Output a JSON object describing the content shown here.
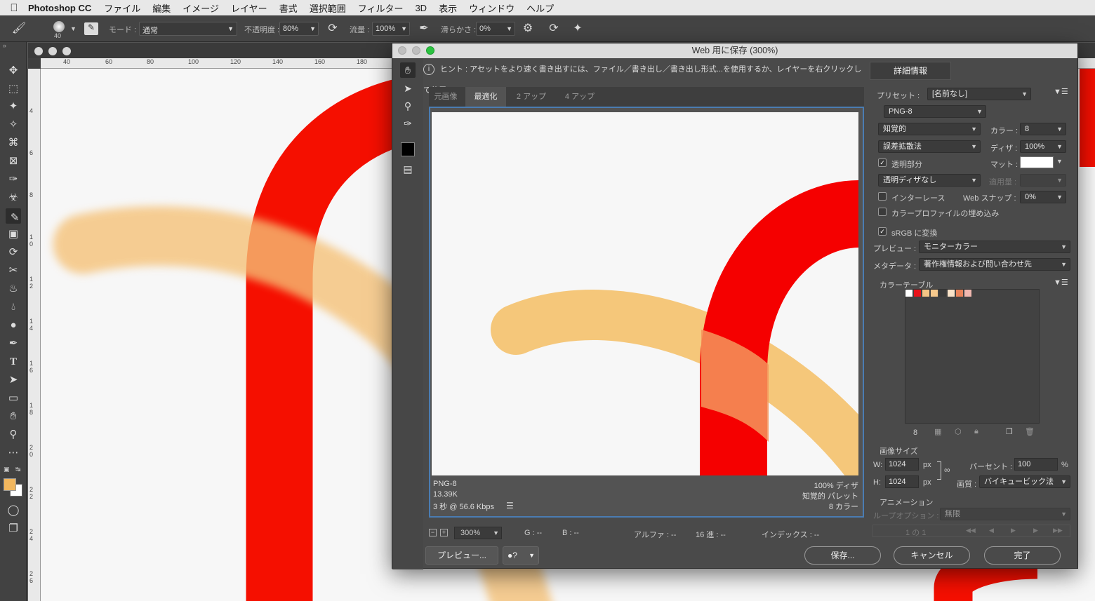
{
  "menubar": {
    "app": "Photoshop CC",
    "items": [
      "ファイル",
      "編集",
      "イメージ",
      "レイヤー",
      "書式",
      "選択範囲",
      "フィルター",
      "3D",
      "表示",
      "ウィンドウ",
      "ヘルプ"
    ]
  },
  "options": {
    "brush_size": "40",
    "mode_label": "モード :",
    "mode_value": "通常",
    "opacity_label": "不透明度 :",
    "opacity_value": "80%",
    "flow_label": "流量 :",
    "flow_value": "100%",
    "smoothing_label": "滑らかさ :",
    "smoothing_value": "0%"
  },
  "ruler": {
    "h_labels": [
      "40",
      "60",
      "80",
      "100",
      "120",
      "140",
      "160",
      "180"
    ],
    "v_labels": [
      "4",
      "6",
      "8",
      "1 0",
      "1 2",
      "1 4",
      "1 6",
      "1 8",
      "2 0",
      "2 2",
      "2 4",
      "2 6"
    ]
  },
  "colors": {
    "foreground": "#f2b75e",
    "background": "#ffffff",
    "red": "#f50f00",
    "orange_stroke": "#f5c176"
  },
  "sfw": {
    "title": "Web 用に保存 (300%)",
    "hint": "ヒント : アセットをより速く書き出すには、ファイル／書き出し／書き出し形式...を使用するか、レイヤーを右クリックして使用。",
    "tabs": [
      "元画像",
      "最適化",
      "2 アップ",
      "4 アップ"
    ],
    "active_tab": "最適化",
    "info_left": [
      "PNG-8",
      "13.39K",
      "3 秒 @ 56.6 Kbps"
    ],
    "info_right": [
      "100% ディザ",
      "知覚的 パレット",
      "8 カラー"
    ],
    "zoom": "300%",
    "readouts": {
      "g": "G : --",
      "b": "B : --",
      "alpha": "アルファ : --",
      "hex": "16 進 : --",
      "index": "インデックス : --"
    },
    "preview_button": "プレビュー...",
    "save_button": "保存...",
    "cancel_button": "キャンセル",
    "done_button": "完了"
  },
  "settings": {
    "detail_button": "詳細情報",
    "preset_label": "プリセット :",
    "preset_value": "[名前なし]",
    "format": "PNG-8",
    "reduction": "知覚的",
    "colors_label": "カラー :",
    "colors_value": "8",
    "dither_algo": "誤差拡散法",
    "dither_label": "ディザ :",
    "dither_value": "100%",
    "transparency_label": "透明部分",
    "matte_label": "マット :",
    "transparency_dither": "透明ディザなし",
    "amount_label": "適用量 :",
    "interlace_label": "インターレース",
    "websnap_label": "Web スナップ :",
    "websnap_value": "0%",
    "embed_profile_label": "カラープロファイルの埋め込み",
    "srgb_label": "sRGB に変換",
    "preview_label": "プレビュー :",
    "preview_value": "モニターカラー",
    "metadata_label": "メタデータ :",
    "metadata_value": "著作権情報および問い合わせ先",
    "color_table_label": "カラーテーブル",
    "color_table": [
      "#ffffff",
      "#e8121a",
      "#f4c585",
      "#f6c98d",
      "#3a3a3a",
      "#f9e2c8",
      "#e9835a",
      "#f1b8b0"
    ],
    "color_count": "8",
    "image_size_label": "画像サイズ",
    "w_label": "W:",
    "w_value": "1024",
    "h_label": "H:",
    "h_value": "1024",
    "px": "px",
    "percent_label": "パーセント :",
    "percent_value": "100",
    "percent_unit": "%",
    "quality_label": "画質 :",
    "quality_value": "バイキュービック法",
    "animation_label": "アニメーション",
    "loop_label": "ループオプション :",
    "loop_value": "無限",
    "frame_counter": "1 の 1"
  }
}
